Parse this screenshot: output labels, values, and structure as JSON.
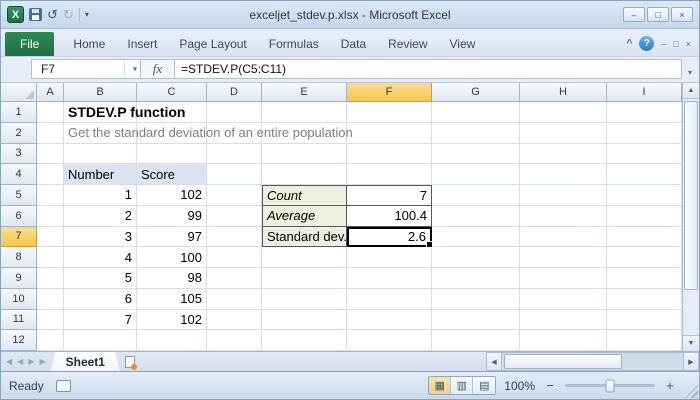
{
  "window": {
    "title": "exceljet_stdev.p.xlsx - Microsoft Excel"
  },
  "icons": {
    "logo": "X",
    "undo": "↺",
    "redo": "↻",
    "dropdown": "▾",
    "minimize": "–",
    "maximize": "□",
    "close": "×",
    "ribbon_collapse": "^",
    "help": "?",
    "up": "▲",
    "down": "▼",
    "left": "◀",
    "right": "▶",
    "view_normal": "▦",
    "view_page_layout": "▥",
    "view_page_break": "▤",
    "zoom_out": "−",
    "zoom_in": "+"
  },
  "ribbon": {
    "tabs": [
      "File",
      "Home",
      "Insert",
      "Page Layout",
      "Formulas",
      "Data",
      "Review",
      "View"
    ]
  },
  "formula_bar": {
    "name_box": "F7",
    "fx_label": "fx",
    "formula": "=STDEV.P(C5:C11)"
  },
  "grid": {
    "col_headers": [
      "A",
      "B",
      "C",
      "D",
      "E",
      "F",
      "G",
      "H",
      "I"
    ],
    "row_headers": [
      "1",
      "2",
      "3",
      "4",
      "5",
      "6",
      "7",
      "8",
      "9",
      "10",
      "11",
      "12"
    ],
    "selected_column": "F",
    "selected_row": "7",
    "active_cell": "F7",
    "cells": {
      "B1": {
        "t": "STDEV.P function",
        "s": "title"
      },
      "B2": {
        "t": "Get the standard deviation of an entire population",
        "s": "subtitle"
      },
      "B4": {
        "t": "Number",
        "s": "th"
      },
      "C4": {
        "t": "Score",
        "s": "th"
      },
      "B5": {
        "t": "1",
        "s": "num"
      },
      "C5": {
        "t": "102",
        "s": "num"
      },
      "B6": {
        "t": "2",
        "s": "num"
      },
      "C6": {
        "t": "99",
        "s": "num"
      },
      "B7": {
        "t": "3",
        "s": "num"
      },
      "C7": {
        "t": "97",
        "s": "num"
      },
      "B8": {
        "t": "4",
        "s": "num"
      },
      "C8": {
        "t": "100",
        "s": "num"
      },
      "B9": {
        "t": "5",
        "s": "num"
      },
      "C9": {
        "t": "98",
        "s": "num"
      },
      "B10": {
        "t": "6",
        "s": "num"
      },
      "C10": {
        "t": "105",
        "s": "num"
      },
      "B11": {
        "t": "7",
        "s": "num"
      },
      "C11": {
        "t": "102",
        "s": "num"
      },
      "E5": {
        "t": "Count",
        "s": "sl it bt"
      },
      "F5": {
        "t": "7",
        "s": "sv num bt"
      },
      "E6": {
        "t": "Average",
        "s": "sl it"
      },
      "F6": {
        "t": "100.4",
        "s": "sv num"
      },
      "E7": {
        "t": "Standard dev.",
        "s": "sl"
      },
      "F7": {
        "t": "2.6",
        "s": "sv num active"
      }
    }
  },
  "sheet_bar": {
    "active_tab": "Sheet1"
  },
  "status_bar": {
    "mode": "Ready",
    "zoom_level": "100%"
  }
}
